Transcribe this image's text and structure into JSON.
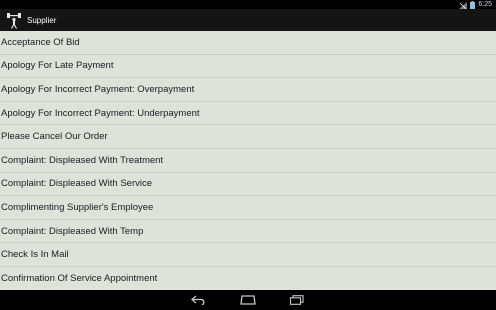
{
  "status_bar": {
    "time": "6:25",
    "icons": [
      "signal-off-icon",
      "battery-icon"
    ]
  },
  "action_bar": {
    "icon": "dumbbell-person-icon",
    "title": "Supplier"
  },
  "list": {
    "items": [
      "Acceptance Of Bid",
      "Apology For Late Payment",
      "Apology For Incorrect Payment: Overpayment",
      "Apology For Incorrect Payment: Underpayment",
      "Please Cancel Our Order",
      "Complaint: Displeased With Treatment",
      "Complaint: Displeased With Service",
      "Complimenting Supplier's Employee",
      "Complaint: Displeased With Temp",
      "Check Is In Mail",
      "Confirmation Of Service Appointment"
    ]
  },
  "nav_bar": {
    "buttons": [
      "back-icon",
      "home-icon",
      "recent-apps-icon"
    ]
  },
  "colors": {
    "list_background": "#dde2db",
    "divider": "#c7ccc5",
    "action_bar": "#141414",
    "text": "#202020"
  }
}
